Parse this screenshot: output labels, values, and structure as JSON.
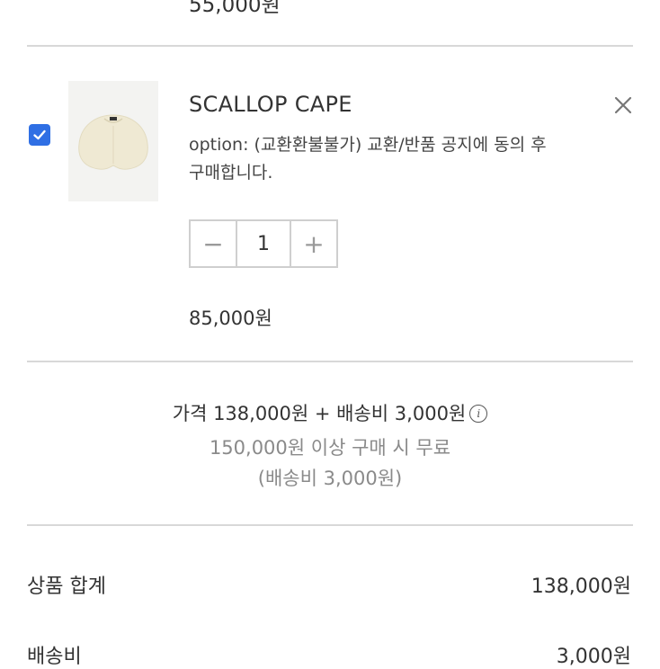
{
  "previous_item": {
    "price": "55,000원"
  },
  "cart_item": {
    "checked": true,
    "name": "SCALLOP CAPE",
    "option": "option: (교환환불불가) 교환/반품 공지에 동의 후 구매합니다.",
    "quantity": "1",
    "decrement_symbol": "−",
    "increment_symbol": "+",
    "price": "85,000원"
  },
  "shipping_summary": {
    "line": "가격 138,000원 + 배송비 3,000원",
    "info_icon": "info-icon",
    "free_condition": "150,000원 이상 구매 시 무료",
    "shipping_fee_note": "(배송비 3,000원)"
  },
  "totals": {
    "subtotal_label": "상품 합계",
    "subtotal_value": "138,000원",
    "shipping_label": "배송비",
    "shipping_value": "3,000원"
  },
  "colors": {
    "checkbox": "#2f6fe4",
    "divider": "#d8d8d8",
    "muted_text": "#8a8a8a"
  }
}
